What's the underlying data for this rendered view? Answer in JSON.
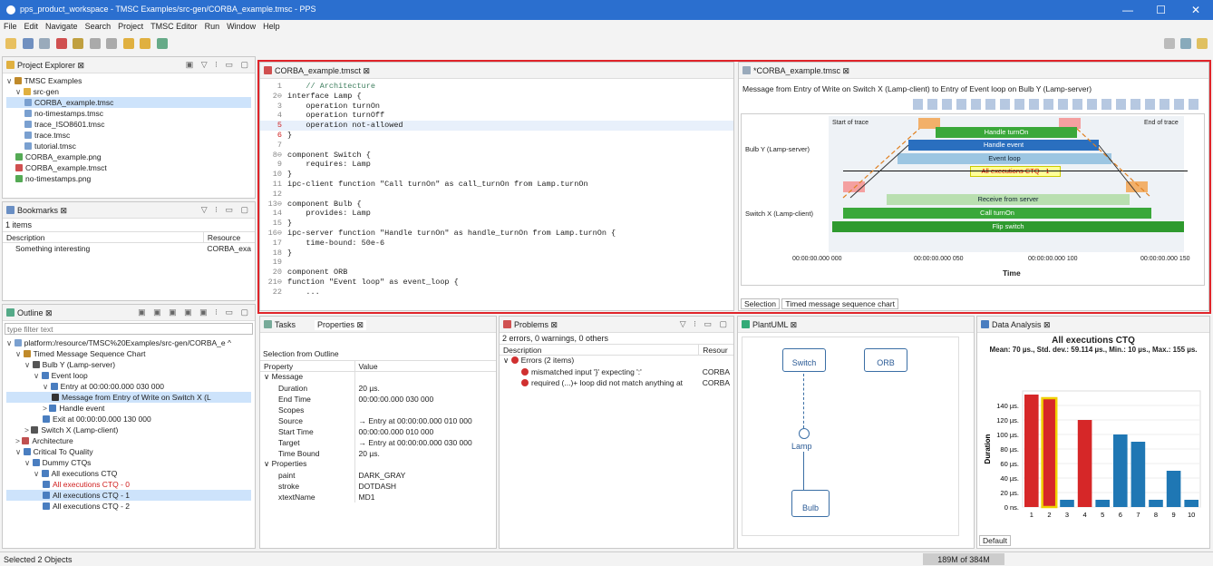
{
  "window": {
    "title": "pps_product_workspace - TMSC Examples/src-gen/CORBA_example.tmsc - PPS",
    "minimize": "—",
    "maximize": "☐",
    "close": "✕"
  },
  "menu": [
    "File",
    "Edit",
    "Navigate",
    "Search",
    "Project",
    "TMSC Editor",
    "Run",
    "Window",
    "Help"
  ],
  "project_explorer": {
    "title": "Project Explorer ⊠",
    "items": [
      {
        "label": "TMSC Examples",
        "indent": 0,
        "arrow": "∨",
        "color": "#c08a2a"
      },
      {
        "label": "src-gen",
        "indent": 1,
        "arrow": "∨",
        "color": "#e0b040"
      },
      {
        "label": "CORBA_example.tmsc",
        "indent": 2,
        "arrow": "",
        "color": "#7aa0d0",
        "selected": true
      },
      {
        "label": "no-timestamps.tmsc",
        "indent": 2,
        "arrow": "",
        "color": "#7aa0d0"
      },
      {
        "label": "trace_ISO8601.tmsc",
        "indent": 2,
        "arrow": "",
        "color": "#7aa0d0"
      },
      {
        "label": "trace.tmsc",
        "indent": 2,
        "arrow": "",
        "color": "#7aa0d0"
      },
      {
        "label": "tutorial.tmsc",
        "indent": 2,
        "arrow": "",
        "color": "#7aa0d0"
      },
      {
        "label": "CORBA_example.png",
        "indent": 1,
        "arrow": "",
        "color": "#55aa55"
      },
      {
        "label": "CORBA_example.tmsct",
        "indent": 1,
        "arrow": "",
        "color": "#d05050"
      },
      {
        "label": "no-timestamps.png",
        "indent": 1,
        "arrow": "",
        "color": "#55aa55"
      }
    ]
  },
  "bookmarks": {
    "title": "Bookmarks ⊠",
    "count": "1 items",
    "col_description": "Description",
    "col_resource": "Resource",
    "rows": [
      {
        "description": "Something interesting",
        "resource": "CORBA_exa"
      }
    ]
  },
  "outline": {
    "title": "Outline ⊠",
    "filter_placeholder": "type filter text",
    "items": [
      {
        "label": "platform:/resource/TMSC%20Examples/src-gen/CORBA_e ^",
        "indent": 0,
        "arrow": "∨",
        "color": "#7aa0d0"
      },
      {
        "label": "Timed Message Sequence Chart",
        "indent": 1,
        "arrow": "∨",
        "color": "#c08a2a"
      },
      {
        "label": "Bulb Y (Lamp-server)",
        "indent": 2,
        "arrow": "∨",
        "color": "#555"
      },
      {
        "label": "Event loop",
        "indent": 3,
        "arrow": "∨",
        "color": "#4a7ec0"
      },
      {
        "label": "Entry at 00:00:00.000 030 000",
        "indent": 4,
        "arrow": "∨",
        "color": "#4a7ec0"
      },
      {
        "label": "Message from Entry of Write on Switch X (L",
        "indent": 5,
        "arrow": "",
        "color": "#333",
        "selected": true
      },
      {
        "label": "Handle event",
        "indent": 4,
        "arrow": ">",
        "color": "#4a7ec0"
      },
      {
        "label": "Exit at 00:00:00.000 130 000",
        "indent": 4,
        "arrow": "",
        "color": "#4a7ec0"
      },
      {
        "label": "Switch X (Lamp-client)",
        "indent": 2,
        "arrow": ">",
        "color": "#555"
      },
      {
        "label": "Architecture",
        "indent": 1,
        "arrow": ">",
        "color": "#c05050"
      },
      {
        "label": "Critical To Quality",
        "indent": 1,
        "arrow": "∨",
        "color": "#4a7ec0"
      },
      {
        "label": "Dummy CTQs",
        "indent": 2,
        "arrow": "∨",
        "color": "#4a7ec0"
      },
      {
        "label": "All executions CTQ",
        "indent": 3,
        "arrow": "∨",
        "color": "#4a7ec0"
      },
      {
        "label": "All executions CTQ - 0",
        "indent": 4,
        "arrow": "",
        "color": "#4a7ec0",
        "red": true
      },
      {
        "label": "All executions CTQ - 1",
        "indent": 4,
        "arrow": "",
        "color": "#4a7ec0",
        "selected": true
      },
      {
        "label": "All executions CTQ - 2",
        "indent": 4,
        "arrow": "",
        "color": "#4a7ec0"
      }
    ]
  },
  "editor": {
    "title": "CORBA_example.tmsct ⊠",
    "lines": [
      {
        "n": "1",
        "t": "    // Architecture",
        "cls": "cm"
      },
      {
        "n": "2⊖",
        "t": "interface Lamp {",
        "kw": "interface"
      },
      {
        "n": "3",
        "t": "    operation turnOn",
        "kw": "operation"
      },
      {
        "n": "4",
        "t": "    operation turnOff",
        "kw": "operation"
      },
      {
        "n": "5",
        "t": "    operation not-allowed",
        "kw": "operation",
        "err": true
      },
      {
        "n": "6",
        "t": "}",
        "err": true
      },
      {
        "n": "7",
        "t": ""
      },
      {
        "n": "8⊖",
        "t": "component Switch {",
        "kw": "component"
      },
      {
        "n": "9",
        "t": "    requires: Lamp",
        "kw": "requires:"
      },
      {
        "n": "10",
        "t": "}"
      },
      {
        "n": "11",
        "t": "ipc-client function \"Call turnOn\" as call_turnOn from Lamp.turnOn",
        "kw": "ipc-client function"
      },
      {
        "n": "12",
        "t": ""
      },
      {
        "n": "13⊖",
        "t": "component Bulb {",
        "kw": "component"
      },
      {
        "n": "14",
        "t": "    provides: Lamp",
        "kw": "provides:"
      },
      {
        "n": "15",
        "t": "}"
      },
      {
        "n": "16⊖",
        "t": "ipc-server function \"Handle turnOn\" as handle_turnOn from Lamp.turnOn {",
        "kw": "ipc-server function"
      },
      {
        "n": "17",
        "t": "    time-bound: 50e-6",
        "kw": "time-bound:"
      },
      {
        "n": "18",
        "t": "}"
      },
      {
        "n": "19",
        "t": ""
      },
      {
        "n": "20",
        "t": "component ORB",
        "kw": "component"
      },
      {
        "n": "21⊖",
        "t": "function \"Event loop\" as event_loop {",
        "kw": "function"
      },
      {
        "n": "22",
        "t": "    ..."
      }
    ]
  },
  "tmsc_view": {
    "title": "*CORBA_example.tmsc ⊠",
    "message": "Message from Entry of Write on Switch X (Lamp-client) to Entry of Event loop on Bulb Y (Lamp-server)",
    "start": "Start of trace",
    "end": "End of trace",
    "lane_bulb": "Bulb Y (Lamp-server)",
    "lane_switch": "Switch X (Lamp-client)",
    "bars": {
      "handle_turnon": "Handle turnOn",
      "handle_event": "Handle event",
      "event_loop": "Event loop",
      "ctq": "All executions CTQ - 1",
      "receive": "Receive from server",
      "call_turnon": "Call turnOn",
      "flip": "Flip switch"
    },
    "ticks": [
      "00:00:00.000 000",
      "00:00:00.000 050",
      "00:00:00.000 100",
      "00:00:00.000 150"
    ],
    "axis": "Time",
    "tab1": "Selection",
    "tab2": "Timed message sequence chart"
  },
  "properties": {
    "tab_tasks": "Tasks",
    "tab_props": "Properties ⊠",
    "heading": "Selection from Outline",
    "col_property": "Property",
    "col_value": "Value",
    "rows": [
      {
        "k": "Message",
        "v": "",
        "group": true
      },
      {
        "k": "Duration",
        "v": "20 µs."
      },
      {
        "k": "End Time",
        "v": "00:00:00.000 030 000"
      },
      {
        "k": "Scopes",
        "v": ""
      },
      {
        "k": "Source",
        "v": "→ Entry at 00:00:00.000 010 000"
      },
      {
        "k": "Start Time",
        "v": "00:00:00.000 010 000"
      },
      {
        "k": "Target",
        "v": "→ Entry at 00:00:00.000 030 000"
      },
      {
        "k": "Time Bound",
        "v": "20 µs."
      },
      {
        "k": "Properties",
        "v": "",
        "group": true
      },
      {
        "k": "paint",
        "v": "DARK_GRAY"
      },
      {
        "k": "stroke",
        "v": "DOTDASH"
      },
      {
        "k": "xtextName",
        "v": "MD1"
      }
    ]
  },
  "problems": {
    "title": "Problems ⊠",
    "summary": "2 errors, 0 warnings, 0 others",
    "col_description": "Description",
    "col_resource": "Resour",
    "group": "Errors (2 items)",
    "rows": [
      {
        "d": "mismatched input '}' expecting ':'",
        "r": "CORBA"
      },
      {
        "d": "required (...)+ loop did not match anything at",
        "r": "CORBA"
      }
    ]
  },
  "plantuml": {
    "title": "PlantUML ⊠",
    "switch": "Switch",
    "orb": "ORB",
    "lamp": "Lamp",
    "bulb": "Bulb"
  },
  "data_analysis": {
    "title": "Data Analysis ⊠",
    "tab": "Default"
  },
  "chart_data": {
    "type": "bar",
    "title": "All executions CTQ",
    "subtitle": "Mean: 70 µs., Std. dev.: 59.114 µs., Min.: 10 µs., Max.: 155 µs.",
    "ylabel": "Duration",
    "ylim": [
      0,
      160
    ],
    "yticks": [
      "0 ns.",
      "20 µs.",
      "40 µs.",
      "60 µs.",
      "80 µs.",
      "100 µs.",
      "120 µs.",
      "140 µs."
    ],
    "categories": [
      "1",
      "2",
      "3",
      "4",
      "5",
      "6",
      "7",
      "8",
      "9",
      "10"
    ],
    "values": [
      155,
      150,
      10,
      120,
      10,
      100,
      90,
      10,
      50,
      10
    ],
    "colors": [
      "#d62728",
      "#d62728",
      "#1f77b4",
      "#d62728",
      "#1f77b4",
      "#1f77b4",
      "#1f77b4",
      "#1f77b4",
      "#1f77b4",
      "#1f77b4"
    ],
    "highlight": 2
  },
  "status": {
    "left": "Selected 2 Objects",
    "memory": "189M of 384M"
  }
}
